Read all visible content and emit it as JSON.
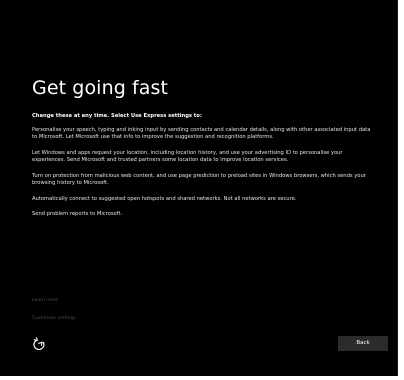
{
  "screen": {
    "title": "Get going fast",
    "intro": "Change these at any time. Select Use Express settings to:",
    "paragraphs": [
      "Personalise your speech, typing and inking input by sending contacts and calendar details, along with other associated input data to Microsoft. Let Microsoft use that info to improve the suggestion and recognition platforms.",
      "Let Windows and apps request your location, including location history, and use your advertising ID to personalise your experiences. Send Microsoft and trusted partners some location data to improve location services.",
      "Turn on protection from malicious web content, and use page prediction to preload sites in Windows browsers, which sends your browsing history to Microsoft.",
      "Automatically connect to suggested open hotspots and shared networks. Not all networks are secure.",
      "Send problem reports to Microsoft."
    ],
    "learn_more_label": "Learn more",
    "customise_label": "Customise settings",
    "back_label": "Back",
    "ease_of_access_icon": "ease-of-access-icon"
  },
  "colors": {
    "background": "#000000",
    "text": "#ffffff",
    "muted_link": "#4a4a4a",
    "button": "#2b2b2b"
  }
}
